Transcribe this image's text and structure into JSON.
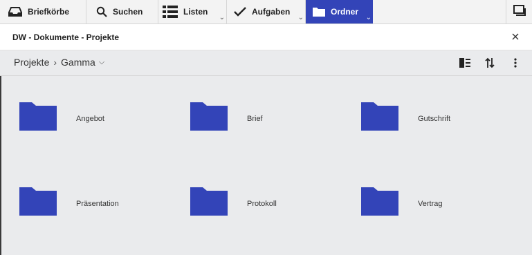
{
  "toolbar": {
    "items": [
      {
        "label": "Briefkörbe",
        "icon": "inbox-tray-icon"
      },
      {
        "label": "Suchen",
        "icon": "search-icon"
      },
      {
        "label": "Listen",
        "icon": "list-icon"
      },
      {
        "label": "Aufgaben",
        "icon": "checkmark-icon"
      },
      {
        "label": "Ordner",
        "icon": "folder-icon",
        "active": true
      }
    ],
    "right_icon": "window-restore-icon"
  },
  "titlebar": {
    "title": "DW - Dokumente - Projekte",
    "close_icon": "close-icon"
  },
  "breadcrumb": {
    "items": [
      "Projekte",
      "Gamma"
    ]
  },
  "folders": [
    {
      "label": "Angebot"
    },
    {
      "label": "Brief"
    },
    {
      "label": "Gutschrift"
    },
    {
      "label": "Präsentation"
    },
    {
      "label": "Protokoll"
    },
    {
      "label": "Vertrag"
    }
  ],
  "colors": {
    "accent": "#3344b8",
    "folder": "#3344b8",
    "background": "#eaebed"
  }
}
